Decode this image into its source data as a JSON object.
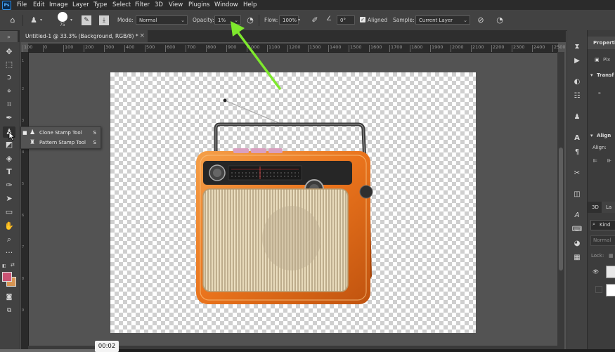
{
  "menubar": {
    "items": [
      "File",
      "Edit",
      "Image",
      "Layer",
      "Type",
      "Select",
      "Filter",
      "3D",
      "View",
      "Plugins",
      "Window",
      "Help"
    ]
  },
  "options": {
    "brush_size": "75",
    "mode_label": "Mode:",
    "mode_value": "Normal",
    "opacity_label": "Opacity:",
    "opacity_value": "1%",
    "flow_label": "Flow:",
    "flow_value": "100%",
    "angle_value": "0°",
    "aligned_label": "Aligned",
    "sample_label": "Sample:",
    "sample_value": "Current Layer"
  },
  "document": {
    "tab_title": "Untitled-1 @ 33.3% (Background, RGB/8) *",
    "close_glyph": "×"
  },
  "ruler": {
    "h_ticks": [
      "100",
      "0",
      "100",
      "200",
      "300",
      "400",
      "500",
      "600",
      "700",
      "800",
      "900",
      "1000",
      "1100",
      "1200",
      "1300",
      "1400",
      "1500",
      "1600",
      "1700",
      "1800",
      "1900",
      "2000",
      "2100",
      "2200",
      "2300",
      "2400",
      "2500"
    ]
  },
  "flyout": {
    "items": [
      {
        "label": "Clone Stamp Tool",
        "shortcut": "S"
      },
      {
        "label": "Pattern Stamp Tool",
        "shortcut": "S"
      }
    ]
  },
  "panel": {
    "properties_title": "Properties",
    "pixel_label": "Pix",
    "transform_label": "Transf",
    "align_title": "Align",
    "align_label": "Align:",
    "tab_3d": "3D",
    "tab_layers": "La",
    "kind_label": "Kind",
    "blend_value": "Normal",
    "lock_label": "Lock:"
  },
  "video": {
    "timestamp": "00:02"
  },
  "colors": {
    "foreground": "#c95374",
    "background": "#d79553",
    "annotation_arrow": "#7ee82d"
  }
}
